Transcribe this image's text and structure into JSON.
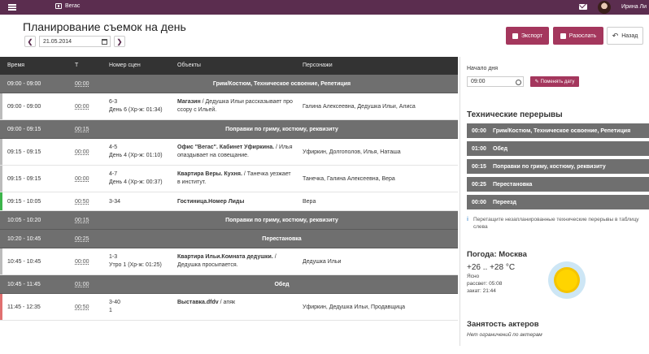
{
  "topbar": {
    "project": "Вегас",
    "user": "Ирина Ли"
  },
  "page": {
    "title": "Планирование съемок на день",
    "date": "21.05.2014"
  },
  "actions": {
    "export": "Экспорт",
    "send": "Разослать",
    "back": "Назад"
  },
  "table": {
    "headers": {
      "time": "Время",
      "t": "Т",
      "scenes": "Номер сцен",
      "objects": "Объекты",
      "characters": "Персонажи"
    },
    "rows": [
      {
        "kind": "break",
        "time": "09:00 - 09:00",
        "dur": "00:00",
        "label": "Грим/Костюм, Техническое освоение, Репетиция"
      },
      {
        "kind": "scene",
        "time": "09:00 - 09:00",
        "dur": "00:00",
        "scene1": "6-3",
        "scene2": "День 6 (Хр-ж: 01:34)",
        "objBold": "Магазин",
        "obj1": " / Дедушка Ильи рассказывает про",
        "obj2": "ссору с Ильей.",
        "chars": "Галина Алексеевна, Дедушка Ильи, Алиса",
        "color": "#bbbbbb"
      },
      {
        "kind": "break",
        "time": "09:00 - 09:15",
        "dur": "00:15",
        "label": "Поправки по гриму, костюму, реквизиту"
      },
      {
        "kind": "scene",
        "time": "09:15 - 09:15",
        "dur": "00:00",
        "scene1": "4-5",
        "scene2": "День 4 (Хр-ж: 01:10)",
        "objBold": "Офис \"Вегас\". Кабинет Уфиркина.",
        "obj1": " / Илья",
        "obj2": "опаздывает на совещание.",
        "chars": "Уфиркин, Долгополов, Илья, Наташа",
        "color": "#bbbbbb"
      },
      {
        "kind": "scene",
        "time": "09:15 - 09:15",
        "dur": "00:00",
        "scene1": "4-7",
        "scene2": "День 4 (Хр-ж: 00:37)",
        "objBold": "Квартира Веры. Кухня.",
        "obj1": " / Танечка уезжает",
        "obj2": "в институт.",
        "chars": "Танечка, Галина Алексеевна, Вера",
        "color": "#bbbbbb"
      },
      {
        "kind": "scene",
        "time": "09:15 - 10:05",
        "dur": "00:50",
        "scene1": "3-34",
        "scene2": "",
        "objBold": "Гостиница.Номер Лиды",
        "obj1": "",
        "obj2": "",
        "chars": "Вера",
        "color": "#3cb44b"
      },
      {
        "kind": "break",
        "time": "10:05 - 10:20",
        "dur": "00:15",
        "label": "Поправки по гриму, костюму, реквизиту"
      },
      {
        "kind": "break",
        "time": "10:20 - 10:45",
        "dur": "00:25",
        "label": "Перестановка"
      },
      {
        "kind": "scene",
        "time": "10:45 - 10:45",
        "dur": "00:00",
        "scene1": "1-3",
        "scene2": "Утро 1 (Хр-ж: 01:25)",
        "objBold": "Квартира Ильи.Комната дедушки.",
        "obj1": " /",
        "obj2": "Дедушка просыпается.",
        "chars": "Дедушка Ильи",
        "color": "#bbbbbb"
      },
      {
        "kind": "break",
        "time": "10:45 - 11:45",
        "dur": "01:00",
        "label": "Обед"
      },
      {
        "kind": "scene",
        "time": "11:45 - 12:35",
        "dur": "00:50",
        "scene1": "3-40",
        "scene2": "1",
        "objBold": "Выставка.dfdv",
        "obj1": " / апяк",
        "obj2": "",
        "chars": "Уфиркин, Дедушка Ильи, Продавщица",
        "color": "#e07070"
      }
    ]
  },
  "sidebar": {
    "start_label": "Начало дня",
    "start_time": "09:00",
    "change_date": "Поменять дату",
    "breaks_title": "Технические перерывы",
    "breaks": [
      {
        "dur": "00:00",
        "label": "Грим/Костюм, Техническое освоение, Репетиция"
      },
      {
        "dur": "01:00",
        "label": "Обед"
      },
      {
        "dur": "00:15",
        "label": "Поправки по гриму, костюму, реквизиту"
      },
      {
        "dur": "00:25",
        "label": "Перестановка"
      },
      {
        "dur": "00:00",
        "label": "Переезд"
      }
    ],
    "hint": "Перетащите незапланированные технические перерывы в таблицу слева",
    "weather_title": "Погода: Москва",
    "temp": "+26 .. +28 °C",
    "cond": "Ясно",
    "sunrise": "рассвет: 05:08",
    "sunset": "закат: 21:44",
    "actors_title": "Занятость актеров",
    "actors_note": "Нет ограничений по актерам"
  },
  "colors": {
    "brand": "#5b2d4f",
    "accent": "#a4375d",
    "break_row": "#6f6f6f",
    "header": "#333333"
  }
}
